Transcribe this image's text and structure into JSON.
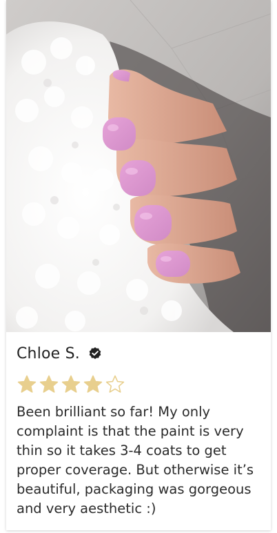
{
  "review": {
    "reviewer_name": "Chloe S.",
    "verified_icon": "verified-check-icon",
    "rating": 4,
    "rating_max": 5,
    "star_color": "#e8cf8e",
    "text": "Been brilliant so far! My only complaint is that the paint is very thin so it takes 3-4 coats to get proper coverage. But otherwise it’s beautiful, packaging was gorgeous and very aesthetic :)"
  }
}
